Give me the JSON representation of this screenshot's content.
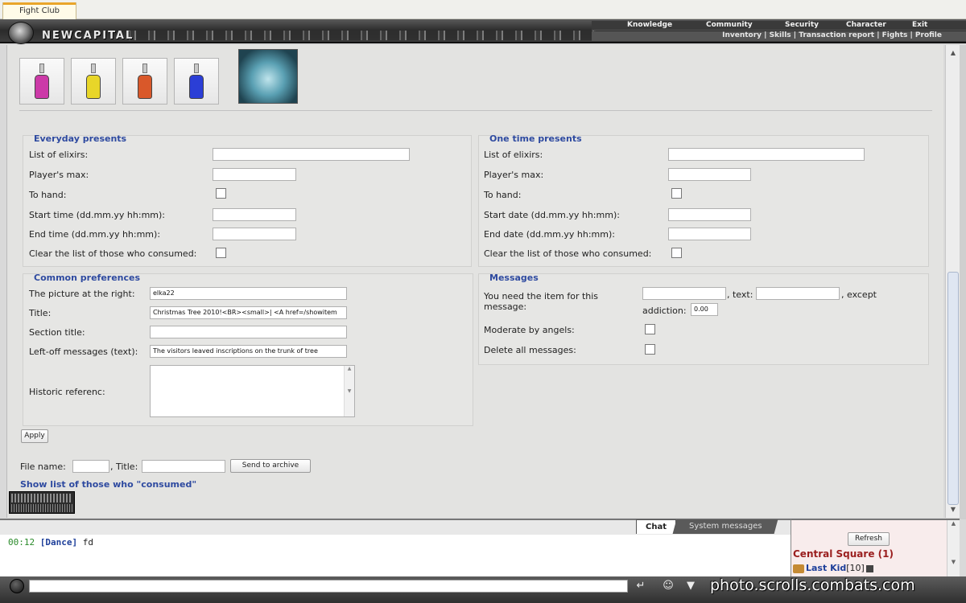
{
  "browser": {
    "tab_title": "Fight Club"
  },
  "header": {
    "logo_text": "NEWCAPITAL",
    "menu": [
      "Knowledge",
      "Community",
      "Security",
      "Character",
      "Exit"
    ],
    "submenu": "Inventory | Skills | Transaction report | Fights | Profile"
  },
  "everyday": {
    "title": "Everyday presents",
    "elixirs_label": "List of elixirs:",
    "max_label": "Player's max:",
    "hand_label": "To hand:",
    "start_label": "Start time (dd.mm.yy hh:mm):",
    "end_label": "End time (dd.mm.yy hh:mm):",
    "clear_label": "Clear the list of those who consumed:"
  },
  "onetime": {
    "title": "One time presents",
    "elixirs_label": "List of elixirs:",
    "max_label": "Player's max:",
    "hand_label": "To hand:",
    "start_label": "Start date (dd.mm.yy hh:mm):",
    "end_label": "End date (dd.mm.yy hh:mm):",
    "clear_label": "Clear the list of those who consumed:"
  },
  "common": {
    "title": "Common preferences",
    "picture_label": "The picture at the right:",
    "picture_value": "elka22",
    "title_label": "Title:",
    "title_value": "Christmas Tree 2010!<BR><small>| <A href=/showitem",
    "section_title_label": "Section title:",
    "leftoff_label": "Left-off messages (text):",
    "leftoff_value": "The visitors leaved inscriptions on the trunk of tree",
    "historic_label": "Historic referenc:"
  },
  "messages": {
    "title": "Messages",
    "need_item_label": "You need the item for this message:",
    "text_label": ", text:",
    "except_label": ", except",
    "addiction_label": "addiction:",
    "addiction_value": "0.00",
    "moderate_label": "Moderate by angels:",
    "delete_label": "Delete all messages:"
  },
  "apply_label": "Apply",
  "archive": {
    "file_label": "File name:",
    "title_label": ", Title:",
    "send_label": "Send to archive"
  },
  "show_list_link": "Show list of those who \"consumed\"",
  "chat": {
    "tab_chat": "Chat",
    "tab_system": "System messages",
    "time": "00:12",
    "user": "[Dance]",
    "text": "fd"
  },
  "online": {
    "refresh_label": "Refresh",
    "location": "Central Square (1)",
    "user": "Last Kid",
    "level": "[10]"
  },
  "watermark": "photo.scrolls.combats.com",
  "colors": {
    "section_title": "#2e4aa0",
    "location": "#9a1e1e",
    "chat_time": "#2a8a2a",
    "elixir_colors": [
      "#cc3aa8",
      "#e8d629",
      "#d9582a",
      "#2b3ed6"
    ]
  },
  "icons": [
    "emblem-icon",
    "scroll-up-icon",
    "scroll-down-icon",
    "enter-icon",
    "smiley-icon",
    "filter-icon"
  ]
}
